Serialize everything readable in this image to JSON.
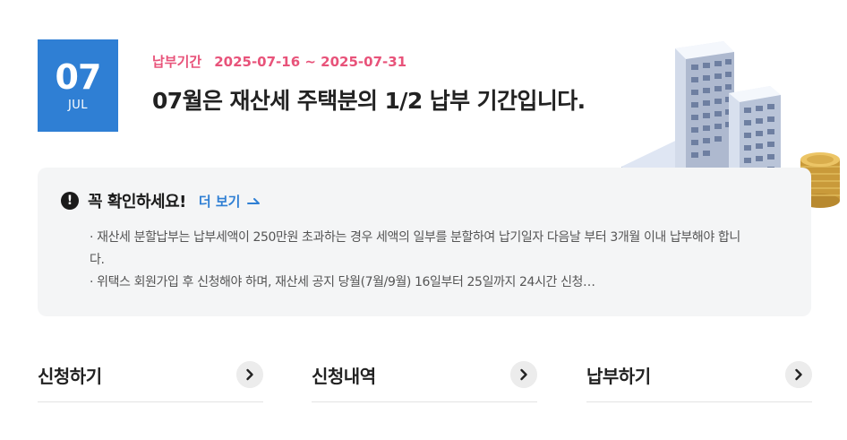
{
  "date": {
    "day": "07",
    "month": "JUL"
  },
  "period": {
    "label": "납부기간",
    "range": "2025-07-16 ~ 2025-07-31"
  },
  "headline": "07월은 재산세 주택분의 1/2 납부 기간입니다.",
  "notice": {
    "icon": "alert-circle-icon",
    "title": "꼭 확인하세요!",
    "more_label": "더 보기",
    "lines": [
      "· 재산세 분할납부는 납부세액이 250만원 초과하는 경우 세액의 일부를 분할하여 납기일자 다음날 부터 3개월 이내 납부해야 합니다.",
      "· 위택스 회원가입 후 신청해야 하며, 재산세 공지 당월(7월/9월) 16일부터 25일까지 24시간 신청…"
    ]
  },
  "menus": [
    {
      "label": "신청하기",
      "icon": "chevron-right-icon"
    },
    {
      "label": "신청내역",
      "icon": "chevron-right-icon"
    },
    {
      "label": "납부하기",
      "icon": "chevron-right-icon"
    }
  ],
  "colors": {
    "accent_blue": "#2f7fd4",
    "period_pink": "#e8537a",
    "notice_bg": "#f4f5f6"
  }
}
